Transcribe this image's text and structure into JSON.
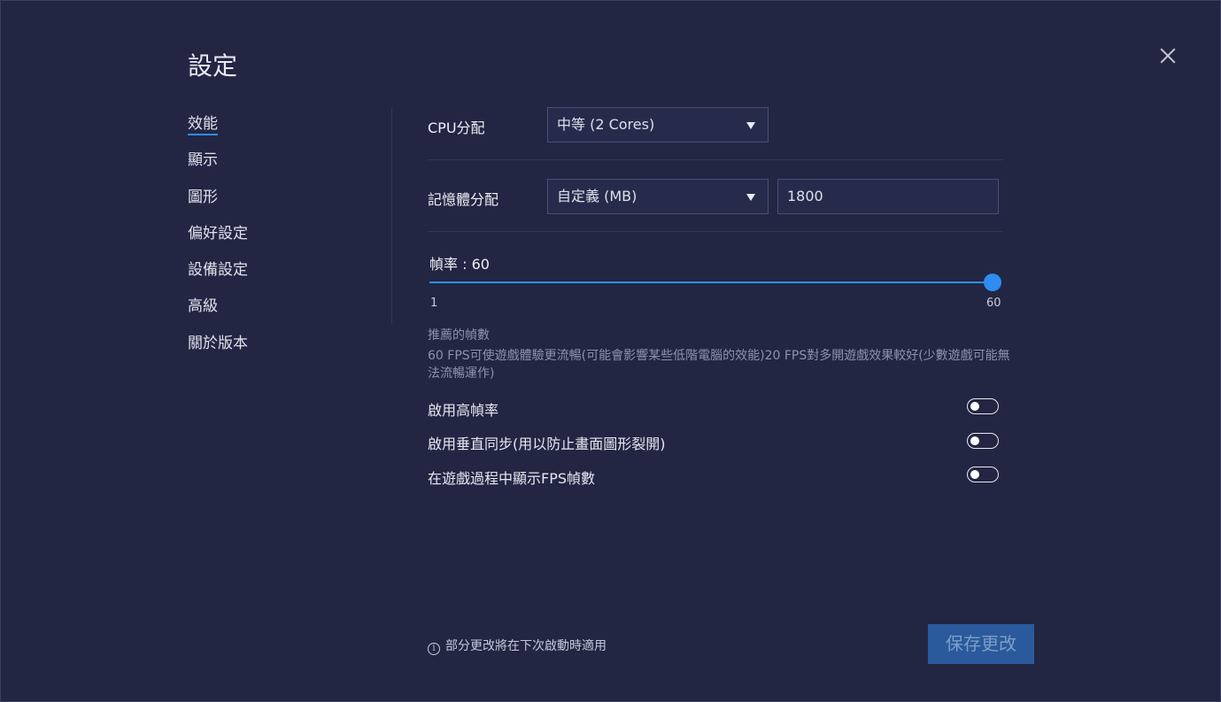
{
  "title": "設定",
  "close_icon": "close-icon",
  "nav": {
    "items": [
      {
        "label": "效能",
        "active": true
      },
      {
        "label": "顯示",
        "active": false
      },
      {
        "label": "圖形",
        "active": false
      },
      {
        "label": "偏好設定",
        "active": false
      },
      {
        "label": "設備設定",
        "active": false
      },
      {
        "label": "高級",
        "active": false
      },
      {
        "label": "關於版本",
        "active": false
      }
    ]
  },
  "cpu": {
    "label": "CPU分配",
    "selected": "中等 (2 Cores)"
  },
  "memory": {
    "label": "記憶體分配",
    "selected": "自定義 (MB)",
    "value": "1800"
  },
  "fps": {
    "label": "幀率 : 60",
    "value": 60,
    "min_label": "1",
    "max_label": "60"
  },
  "hint": {
    "title": "推薦的幀數",
    "body": "60 FPS可使遊戲體驗更流暢(可能會影響某些低階電腦的效能)20 FPS對多開遊戲效果較好(少數遊戲可能無法流暢運作)"
  },
  "toggles": [
    {
      "label": "啟用高幀率",
      "on": false
    },
    {
      "label": "啟用垂直同步(用以防止畫面圖形裂開)",
      "on": false
    },
    {
      "label": "在遊戲過程中顯示FPS幀數",
      "on": false
    }
  ],
  "footer": {
    "info_icon": "i",
    "note": "部分更改將在下次啟動時適用",
    "save_label": "保存更改"
  },
  "colors": {
    "background": "#222643",
    "accent": "#2f8cf0",
    "save_button": "#2a5a9c"
  }
}
